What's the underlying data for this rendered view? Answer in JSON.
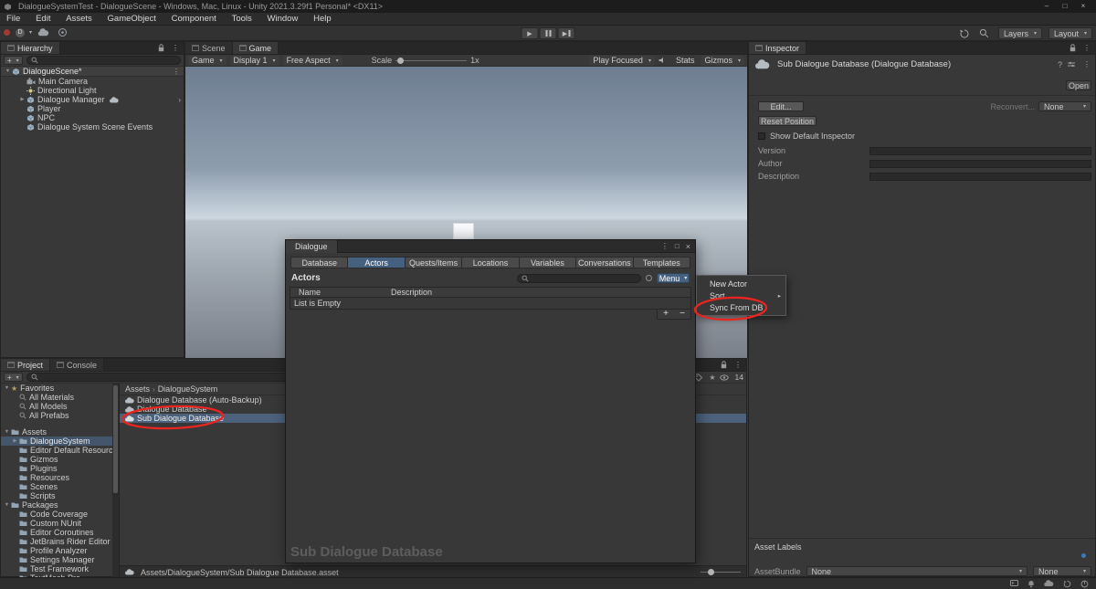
{
  "icons": {
    "dropdown": "▾",
    "kebab": "⋮",
    "close": "×",
    "minimize": "–",
    "maximize": "□",
    "foldout_open": "▼",
    "foldout_closed": "▶",
    "submenu_arrow": "▸",
    "chevron_right": "›",
    "breadcrumb_sep": "›",
    "plus": "+",
    "minus": "−",
    "star": "★",
    "play": "▶",
    "help": "?"
  },
  "title_bar": {
    "title": "DialogueSystemTest - DialogueScene - Windows, Mac, Linux - Unity 2021.3.29f1 Personal* <DX11>"
  },
  "menu_bar": [
    "File",
    "Edit",
    "Assets",
    "GameObject",
    "Component",
    "Tools",
    "Window",
    "Help"
  ],
  "toolbar": {
    "account_initial": "D",
    "layers_label": "Layers",
    "layout_label": "Layout"
  },
  "hierarchy": {
    "tab_label": "Hierarchy",
    "scene_name": "DialogueScene*",
    "items": [
      {
        "label": "Main Camera"
      },
      {
        "label": "Directional Light"
      },
      {
        "label": "Dialogue Manager"
      },
      {
        "label": "Player"
      },
      {
        "label": "NPC"
      },
      {
        "label": "Dialogue System Scene Events"
      }
    ]
  },
  "game_view": {
    "scene_tab": "Scene",
    "game_tab": "Game",
    "target_dropdown": "Game",
    "display_dropdown": "Display 1",
    "aspect_dropdown": "Free Aspect",
    "scale_label": "Scale",
    "scale_value": "1x",
    "play_focused_dropdown": "Play Focused",
    "stats_button": "Stats",
    "gizmos_dropdown": "Gizmos"
  },
  "dialogue_window": {
    "title": "Dialogue",
    "tabs": [
      "Database",
      "Actors",
      "Quests/Items",
      "Locations",
      "Variables",
      "Conversations",
      "Templates"
    ],
    "active_tab": "Actors",
    "section_label": "Actors",
    "menu_button": "Menu",
    "column_name": "Name",
    "column_description": "Description",
    "empty_message": "List is Empty",
    "database_watermark": "Sub Dialogue Database"
  },
  "context_menu": {
    "items": [
      {
        "label": "New Actor"
      },
      {
        "label": "Sort"
      },
      {
        "label": "Sync From DB"
      }
    ]
  },
  "inspector": {
    "tab_label": "Inspector",
    "header_title": "Sub Dialogue Database (Dialogue Database)",
    "open_button": "Open",
    "edit_button": "Edit...",
    "reconvert_label": "Reconvert...",
    "reconvert_value": "None",
    "reset_position_button": "Reset Position",
    "show_default_inspector_label": "Show Default Inspector",
    "version_label": "Version",
    "author_label": "Author",
    "description_label": "Description",
    "asset_labels_header": "Asset Labels",
    "assetbundle_label": "AssetBundle",
    "assetbundle_value": "None",
    "assetbundle_variant_value": "None"
  },
  "project": {
    "project_tab": "Project",
    "console_tab": "Console",
    "hidden_count": "14",
    "favorites_label": "Favorites",
    "favorites": [
      "All Materials",
      "All Models",
      "All Prefabs"
    ],
    "assets_label": "Assets",
    "asset_folders": [
      "DialogueSystem",
      "Editor Default Resources",
      "Gizmos",
      "Plugins",
      "Resources",
      "Scenes",
      "Scripts"
    ],
    "packages_label": "Packages",
    "package_folders": [
      "Code Coverage",
      "Custom NUnit",
      "Editor Coroutines",
      "JetBrains Rider Editor",
      "Profile Analyzer",
      "Settings Manager",
      "Test Framework",
      "TextMesh Pro"
    ],
    "breadcrumb_root": "Assets",
    "breadcrumb_current": "DialogueSystem",
    "files": [
      {
        "label": "Dialogue Database (Auto-Backup)"
      },
      {
        "label": "Dialogue Database"
      },
      {
        "label": "Sub Dialogue Database"
      }
    ],
    "path_bar": "Assets/DialogueSystem/Sub Dialogue Database.asset"
  },
  "colors": {
    "selection_blue": "#46617f",
    "annotation_red": "#e8251f"
  }
}
